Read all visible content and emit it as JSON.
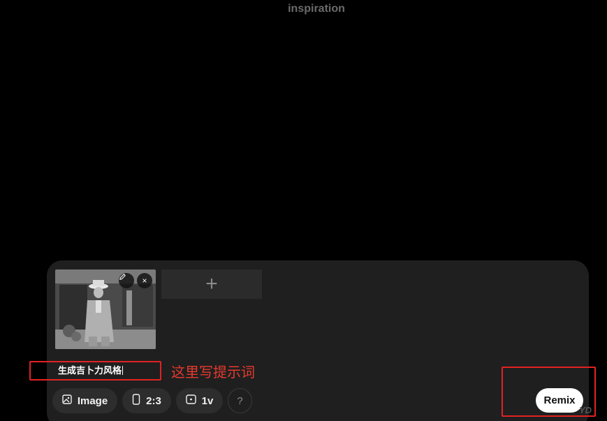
{
  "header": {
    "title": "inspiration"
  },
  "composer": {
    "image_thumb_alt": "Man in light suit and hat (black & white photo)",
    "edit_icon": "pencil-icon",
    "close_icon": "close-icon",
    "close_label": "×",
    "add_label": "+",
    "prompt_text": "生成吉卜力风格",
    "annotation": "这里写提示词"
  },
  "toolbar": {
    "image_label": "Image",
    "ratio_label": "2:3",
    "version_label": "1v",
    "help_label": "?",
    "remix_label": "Remix"
  },
  "colors": {
    "highlight": "#e22222",
    "annotation": "#e63a2e",
    "panel": "#1f1f1f"
  }
}
